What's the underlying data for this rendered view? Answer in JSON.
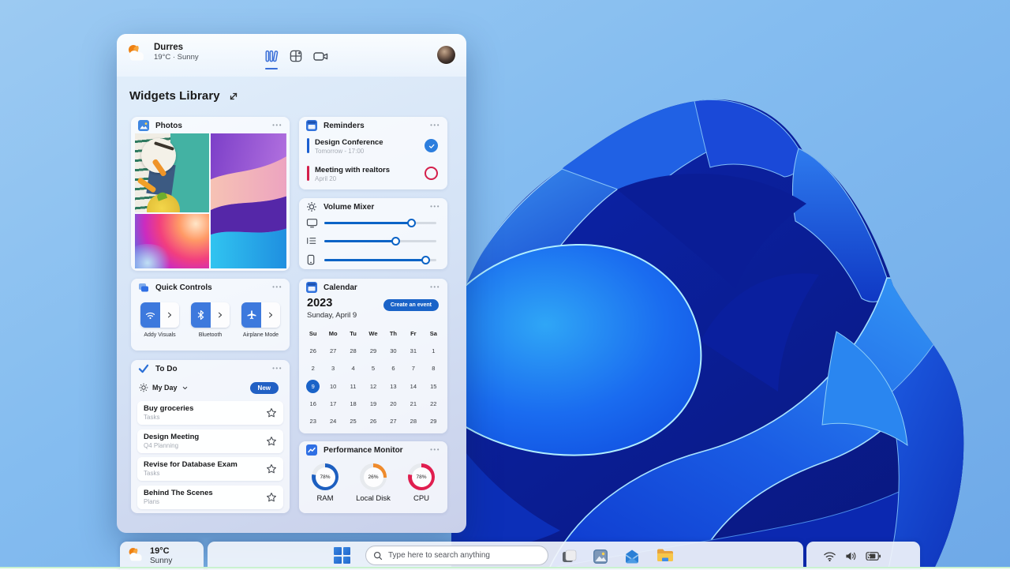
{
  "panel": {
    "header": {
      "location": "Durres",
      "status": "19°C · Sunny",
      "tabs": [
        "library",
        "widgets-board",
        "camera"
      ]
    },
    "title": "Widgets Library",
    "widgets": {
      "photos": {
        "title": "Photos",
        "menu": "•••"
      },
      "reminders": {
        "title": "Reminders",
        "menu": "•••",
        "items": [
          {
            "title": "Design Conference",
            "time": "Tomorrow - 17:00",
            "accent": "#1b5fd0",
            "state": "done"
          },
          {
            "title": "Meeting with realtors",
            "time": "April 20",
            "accent": "#d41f4b",
            "state": "open"
          }
        ]
      },
      "volume_mixer": {
        "title": "Volume Mixer",
        "menu": "•••",
        "sliders": [
          {
            "device": "display",
            "value": 78
          },
          {
            "device": "queue",
            "value": 64
          },
          {
            "device": "phone",
            "value": 91
          }
        ]
      },
      "quick_controls": {
        "title": "Quick Controls",
        "menu": "•••",
        "controls": [
          {
            "label": "Addy Visuals",
            "icon": "wifi"
          },
          {
            "label": "Bluetooth",
            "icon": "bluetooth"
          },
          {
            "label": "Airplane Mode",
            "icon": "airplane"
          }
        ]
      },
      "calendar": {
        "title": "Calendar",
        "menu": "•••",
        "year": "2023",
        "date_line": "Sunday, April 9",
        "button": "Create an event",
        "day_headers": [
          "Su",
          "Mo",
          "Tu",
          "We",
          "Th",
          "Fr",
          "Sa"
        ],
        "weeks": [
          [
            "26",
            "27",
            "28",
            "29",
            "30",
            "31",
            "1"
          ],
          [
            "2",
            "3",
            "4",
            "5",
            "6",
            "7",
            "8"
          ],
          [
            "9",
            "10",
            "11",
            "12",
            "13",
            "14",
            "15"
          ],
          [
            "16",
            "17",
            "18",
            "19",
            "20",
            "21",
            "22"
          ],
          [
            "23",
            "24",
            "25",
            "26",
            "27",
            "28",
            "29"
          ]
        ],
        "selected_day": "9"
      },
      "todo": {
        "title": "To Do",
        "menu": "•••",
        "list_name": "My Day",
        "new_button": "New",
        "tasks": [
          {
            "title": "Buy groceries",
            "list": "Tasks"
          },
          {
            "title": "Design Meeting",
            "list": "Q4 Planning"
          },
          {
            "title": "Revise for Database Exam",
            "list": "Tasks"
          },
          {
            "title": "Behind The Scenes",
            "list": "Plans"
          }
        ]
      },
      "performance": {
        "title": "Performance Monitor",
        "menu": "•••",
        "gauges": [
          {
            "label": "RAM",
            "value": "78%",
            "pct": 78,
            "color": "#1d5fc0"
          },
          {
            "label": "Local Disk",
            "value": "26%",
            "pct": 26,
            "color": "#ef8b2c"
          },
          {
            "label": "CPU",
            "value": "78%",
            "pct": 78,
            "color": "#e01e4f"
          }
        ]
      }
    }
  },
  "taskbar": {
    "weather": {
      "temp": "19°C",
      "condition": "Sunny"
    },
    "search_placeholder": "Type here to search anything",
    "apps": [
      "task-view",
      "photos",
      "mail",
      "file-explorer"
    ],
    "system": [
      "wifi",
      "volume",
      "battery"
    ]
  },
  "chart_data": {
    "type": "table",
    "title": "Performance Monitor",
    "categories": [
      "RAM",
      "Local Disk",
      "CPU"
    ],
    "values": [
      78,
      26,
      78
    ]
  }
}
